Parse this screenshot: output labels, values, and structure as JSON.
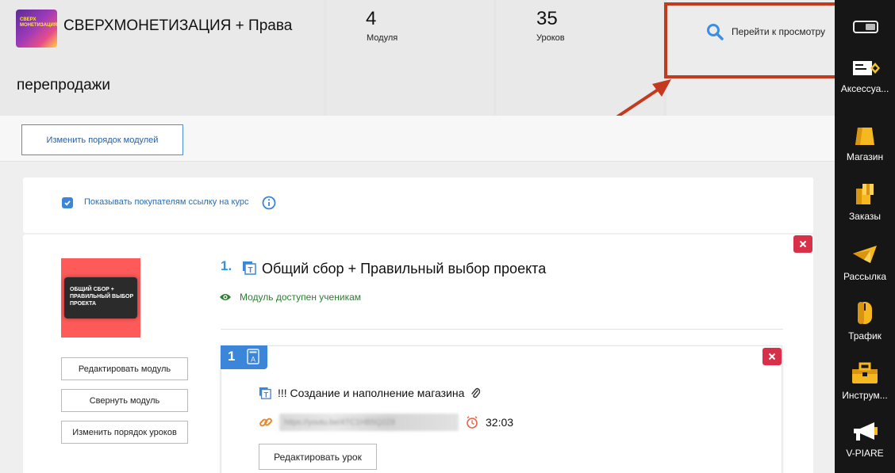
{
  "header": {
    "course_title_line1": "СВЕРХМОНЕТИЗАЦИЯ + Права",
    "course_title_line2": "перепродажи",
    "thumb_text": "СВЕРХ МОНЕТИЗАЦИЯ",
    "stats": [
      {
        "value": "4",
        "label": "Модуля"
      },
      {
        "value": "35",
        "label": "Уроков"
      }
    ],
    "preview_label": "Перейти к просмотру"
  },
  "toolbar": {
    "reorder_modules_label": "Изменить порядок модулей"
  },
  "course_link": {
    "checked": true,
    "label": "Показывать покупателям ссылку на курс"
  },
  "module": {
    "number": "1.",
    "title": "Общий сбор + Правильный выбор проекта",
    "status": "Модуль доступен ученикам",
    "thumb_text": "ОБЩИЙ СБОР + ПРАВИЛЬНЫЙ ВЫБОР ПРОЕКТА",
    "buttons": {
      "edit": "Редактировать модуль",
      "collapse": "Свернуть модуль",
      "reorder_lessons": "Изменить порядок уроков"
    }
  },
  "lesson": {
    "number": "1",
    "title": "!!! Создание и наполнение магазина",
    "url": "https://youtu.be/4TC1HB5Q2Z8",
    "duration": "32:03",
    "edit_label": "Редактировать урок"
  },
  "sidebar": {
    "items": [
      {
        "label": "Аксессуа...",
        "icon": "accessories-icon"
      },
      {
        "label": "Магазин",
        "icon": "shopping-bag-icon"
      },
      {
        "label": "Заказы",
        "icon": "orders-icon"
      },
      {
        "label": "Рассылка",
        "icon": "mailing-icon"
      },
      {
        "label": "Трафик",
        "icon": "traffic-mouse-icon"
      },
      {
        "label": "Инструм...",
        "icon": "toolbox-icon"
      },
      {
        "label": "V-PIARE",
        "icon": "megaphone-icon"
      }
    ]
  },
  "colors": {
    "accent": "#3b86d8",
    "danger": "#d9304a",
    "highlight": "#c43a1e",
    "success": "#2e7d32",
    "sidebar_bg": "#161616"
  }
}
